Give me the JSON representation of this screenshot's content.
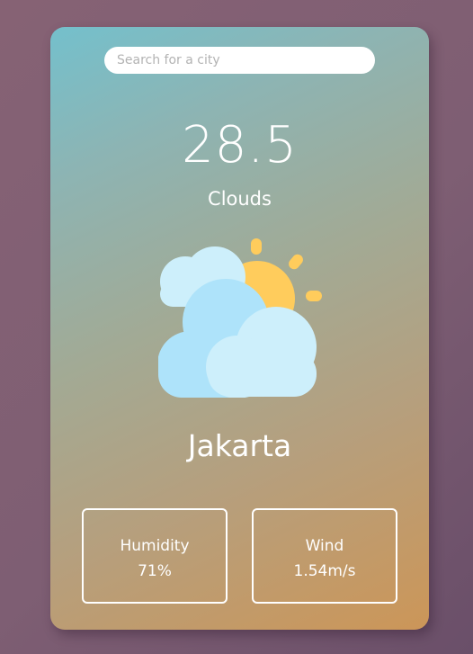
{
  "search": {
    "placeholder": "Search for a city",
    "value": ""
  },
  "weather": {
    "temperature": "28.5",
    "description": "Clouds",
    "icon": "cloudy-sun-icon",
    "city": "Jakarta"
  },
  "stats": {
    "humidity": {
      "label": "Humidity",
      "value": "71%"
    },
    "wind": {
      "label": "Wind",
      "value": "1.54m/s"
    }
  },
  "colors": {
    "background": "#7e5e73",
    "card_gradient_start": "#74c0cc",
    "card_gradient_end": "#cc9658",
    "text": "#ffffff",
    "sun": "#ffcc5c",
    "cloud_light": "#cdeffb",
    "cloud_dark": "#aee3fa"
  }
}
